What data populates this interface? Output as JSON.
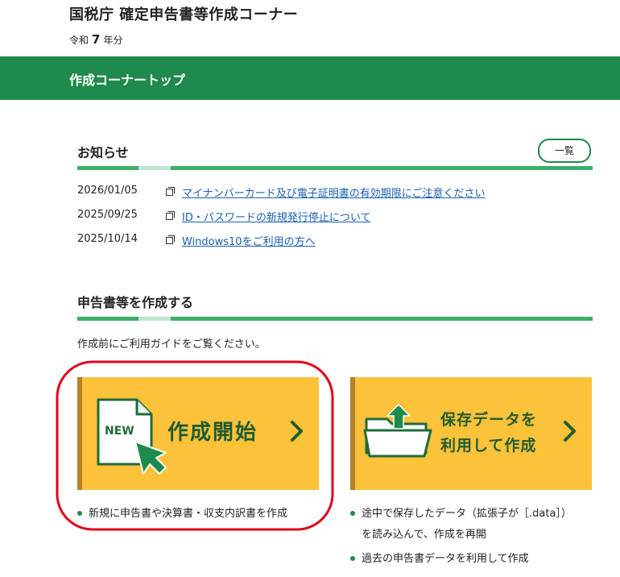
{
  "header": {
    "title": "国税庁 確定申告書等作成コーナー",
    "year_prefix": "令和",
    "year_number": "7",
    "year_suffix": "年分"
  },
  "navbar": {
    "label": "作成コーナートップ"
  },
  "news": {
    "heading": "お知らせ",
    "list_button": "一覧",
    "items": [
      {
        "date": "2026/01/05",
        "text": "マイナンバーカード及び電子証明書の有効期限にご注意ください"
      },
      {
        "date": "2025/09/25",
        "text": "ID・パスワードの新規発行停止について"
      },
      {
        "date": "2025/10/14",
        "text": "Windows10をご利用の方へ"
      }
    ]
  },
  "create": {
    "heading": "申告書等を作成する",
    "guide_text": "作成前にご利用ガイドをご覧ください。",
    "new_card": {
      "badge": "NEW",
      "label": "作成開始",
      "bullets": [
        "新規に申告書や決算書・収支内訳書を作成"
      ]
    },
    "saved_card": {
      "label_line1": "保存データを",
      "label_line2": "利用して作成",
      "bullets": [
        "途中で保存したデータ（拡張子が［.data］）",
        "を読み込んで、作成を再開",
        "過去の申告書データを利用して作成"
      ]
    }
  },
  "colors": {
    "brand_green": "#1e8a4c",
    "card_yellow": "#fcc23a",
    "highlight_red": "#e0001b",
    "link_blue": "#1a5fb4"
  }
}
